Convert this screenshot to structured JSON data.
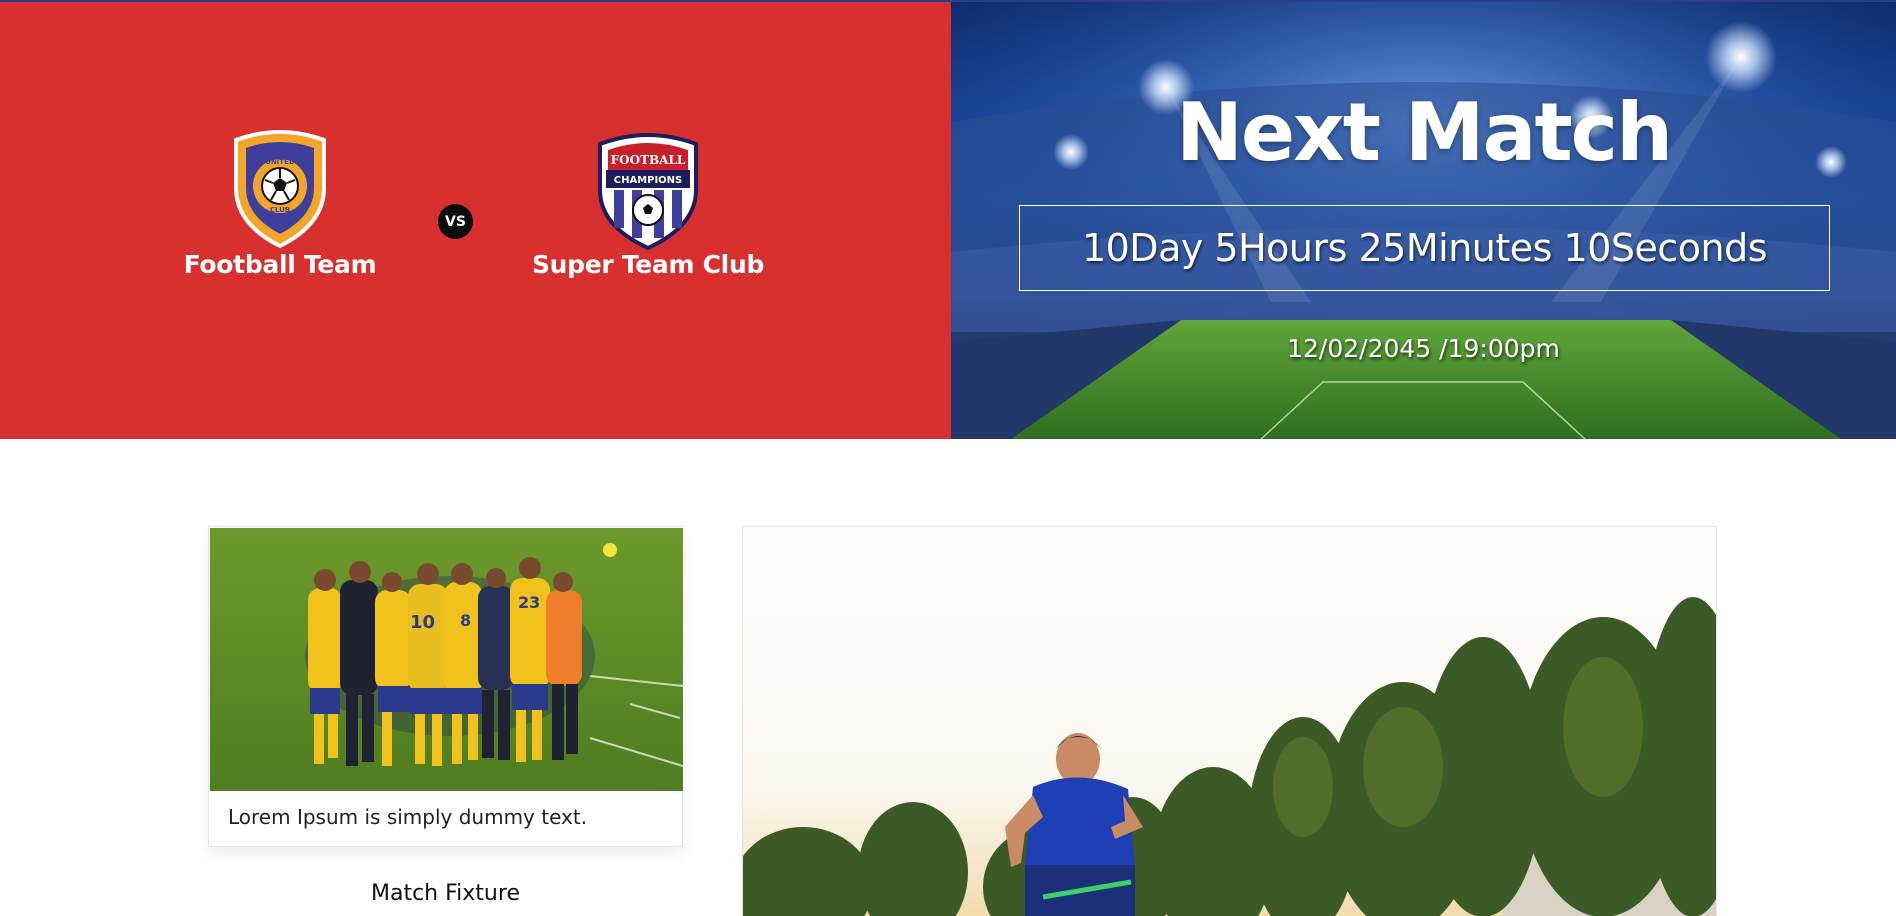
{
  "matchup": {
    "home_team": {
      "name": "Football Team",
      "crest_text": "UNITED CLUB"
    },
    "away_team": {
      "name": "Super Team Club",
      "crest_text_top": "FOOTBALL",
      "crest_text_bottom": "CHAMPIONS"
    },
    "vs_label": "VS",
    "colors": {
      "background": "#d82f2f",
      "vs_badge": "#0c0c0c"
    }
  },
  "next_match": {
    "title": "Next Match",
    "countdown": "10Day 5Hours 25Minutes 10Seconds",
    "date_time": "12/02/2045 /19:00pm"
  },
  "card": {
    "caption": "Lorem Ipsum is simply dummy text."
  },
  "fixture": {
    "label": "Match Fixture"
  },
  "colors": {
    "accent_red": "#d82f2f",
    "stadium_blue": "#1d4fa8",
    "pitch_green": "#4a8a2a"
  }
}
